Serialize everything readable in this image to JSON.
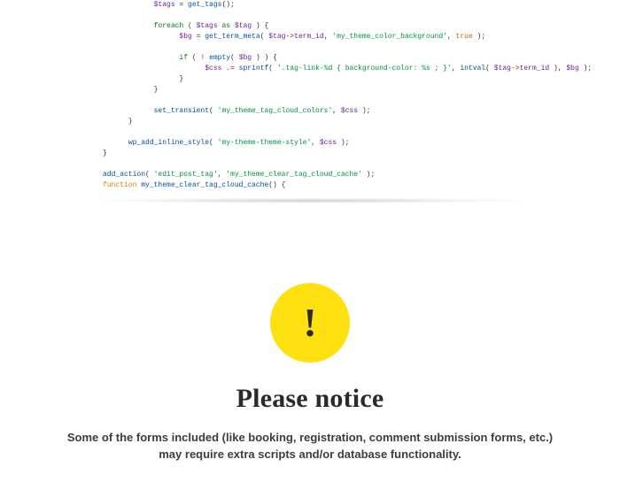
{
  "code": {
    "lines": [
      {
        "indent": 4,
        "parts": [
          {
            "t": "$tags",
            "c": "tok-var"
          },
          {
            "t": " = "
          },
          {
            "t": "get_tags",
            "c": "tok-fn"
          },
          {
            "t": "();"
          }
        ]
      },
      {
        "indent": 0,
        "parts": [
          {
            "t": " "
          }
        ]
      },
      {
        "indent": 4,
        "parts": [
          {
            "t": "foreach",
            "c": "tok-kw"
          },
          {
            "t": " ( "
          },
          {
            "t": "$tags",
            "c": "tok-var"
          },
          {
            "t": " "
          },
          {
            "t": "as",
            "c": "tok-kw"
          },
          {
            "t": " "
          },
          {
            "t": "$tag",
            "c": "tok-var"
          },
          {
            "t": " ) {"
          }
        ]
      },
      {
        "indent": 6,
        "parts": [
          {
            "t": "$bg",
            "c": "tok-var"
          },
          {
            "t": " = "
          },
          {
            "t": "get_term_meta",
            "c": "tok-fn"
          },
          {
            "t": "( "
          },
          {
            "t": "$tag",
            "c": "tok-var"
          },
          {
            "t": "->",
            "c": "tok-op"
          },
          {
            "t": "term_id",
            "c": "tok-var"
          },
          {
            "t": ", "
          },
          {
            "t": "'my_theme_color_background'",
            "c": "tok-str"
          },
          {
            "t": ", "
          },
          {
            "t": "true",
            "c": "tok-bool"
          },
          {
            "t": " );"
          }
        ]
      },
      {
        "indent": 0,
        "parts": [
          {
            "t": " "
          }
        ]
      },
      {
        "indent": 6,
        "parts": [
          {
            "t": "if",
            "c": "tok-kw"
          },
          {
            "t": " ( "
          },
          {
            "t": "!",
            "c": "tok-op"
          },
          {
            "t": " "
          },
          {
            "t": "empty",
            "c": "tok-fn"
          },
          {
            "t": "( "
          },
          {
            "t": "$bg",
            "c": "tok-var"
          },
          {
            "t": " ) ) {"
          }
        ]
      },
      {
        "indent": 8,
        "parts": [
          {
            "t": "$css",
            "c": "tok-var"
          },
          {
            "t": " "
          },
          {
            "t": ".=",
            "c": "tok-op"
          },
          {
            "t": " "
          },
          {
            "t": "sprintf",
            "c": "tok-fn"
          },
          {
            "t": "( "
          },
          {
            "t": "'.tag-link-%d { background-color: %s ; }'",
            "c": "tok-str"
          },
          {
            "t": ", "
          },
          {
            "t": "intval",
            "c": "tok-fn"
          },
          {
            "t": "( "
          },
          {
            "t": "$tag",
            "c": "tok-var"
          },
          {
            "t": "->",
            "c": "tok-op"
          },
          {
            "t": "term_id",
            "c": "tok-var"
          },
          {
            "t": " ), "
          },
          {
            "t": "$bg",
            "c": "tok-var"
          },
          {
            "t": " );"
          }
        ]
      },
      {
        "indent": 6,
        "parts": [
          {
            "t": "}"
          }
        ]
      },
      {
        "indent": 4,
        "parts": [
          {
            "t": "}"
          }
        ]
      },
      {
        "indent": 0,
        "parts": [
          {
            "t": " "
          }
        ]
      },
      {
        "indent": 4,
        "parts": [
          {
            "t": "set_transient",
            "c": "tok-fn"
          },
          {
            "t": "( "
          },
          {
            "t": "'my_theme_tag_cloud_colors'",
            "c": "tok-str"
          },
          {
            "t": ", "
          },
          {
            "t": "$css",
            "c": "tok-var"
          },
          {
            "t": " );"
          }
        ]
      },
      {
        "indent": 2,
        "parts": [
          {
            "t": "}"
          }
        ]
      },
      {
        "indent": 0,
        "parts": [
          {
            "t": " "
          }
        ]
      },
      {
        "indent": 2,
        "parts": [
          {
            "t": "wp_add_inline_style",
            "c": "tok-fn"
          },
          {
            "t": "( "
          },
          {
            "t": "'my-theme-theme-style'",
            "c": "tok-str"
          },
          {
            "t": ", "
          },
          {
            "t": "$css",
            "c": "tok-var"
          },
          {
            "t": " );"
          }
        ]
      },
      {
        "indent": 0,
        "parts": [
          {
            "t": "}"
          }
        ]
      },
      {
        "indent": 0,
        "parts": [
          {
            "t": " "
          }
        ]
      },
      {
        "indent": 0,
        "parts": [
          {
            "t": "add_action",
            "c": "tok-fn"
          },
          {
            "t": "( "
          },
          {
            "t": "'edit_post_tag'",
            "c": "tok-str"
          },
          {
            "t": ", "
          },
          {
            "t": "'my_theme_clear_tag_cloud_cache'",
            "c": "tok-str"
          },
          {
            "t": " );"
          }
        ]
      },
      {
        "indent": 0,
        "parts": [
          {
            "t": "function",
            "c": "tok-orange"
          },
          {
            "t": " "
          },
          {
            "t": "my_theme_clear_tag_cloud_cache",
            "c": "tok-fn"
          },
          {
            "t": "() {"
          }
        ]
      }
    ]
  },
  "notice": {
    "icon_glyph": "!",
    "title": "Please notice",
    "body_line1": "Some of the forms included (like booking, registration, comment submission forms, etc.)",
    "body_line2": "may require extra scripts and/or database functionality."
  }
}
